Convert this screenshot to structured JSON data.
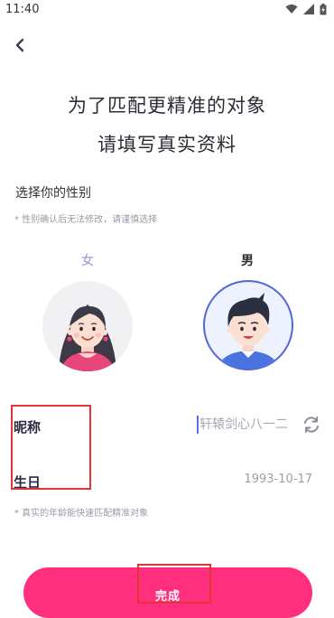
{
  "status_bar": {
    "time": "11:40"
  },
  "header": {
    "line1": "为了匹配更精准的对象",
    "line2": "请填写真实资料"
  },
  "gender": {
    "title": "选择你的性别",
    "hint": "* 性别确认后无法修改，请谨慎选择",
    "female_label": "女",
    "male_label": "男"
  },
  "form": {
    "nickname_label": "昵称",
    "nickname_value": "轩辕剑心八一二",
    "birthday_label": "生日",
    "birthday_value": "1993-10-17",
    "birthday_hint": "* 真实的年龄能快速匹配精准对象"
  },
  "actions": {
    "finish_label": "完成"
  },
  "colors": {
    "accent": "#ff2f7d",
    "male_ring": "#5068d8",
    "female_label": "#9b8fd0",
    "annotation": "#e53333"
  },
  "icons": [
    "back-chevron-icon",
    "wifi-icon",
    "signal-icon",
    "battery-icon",
    "refresh-icon"
  ]
}
